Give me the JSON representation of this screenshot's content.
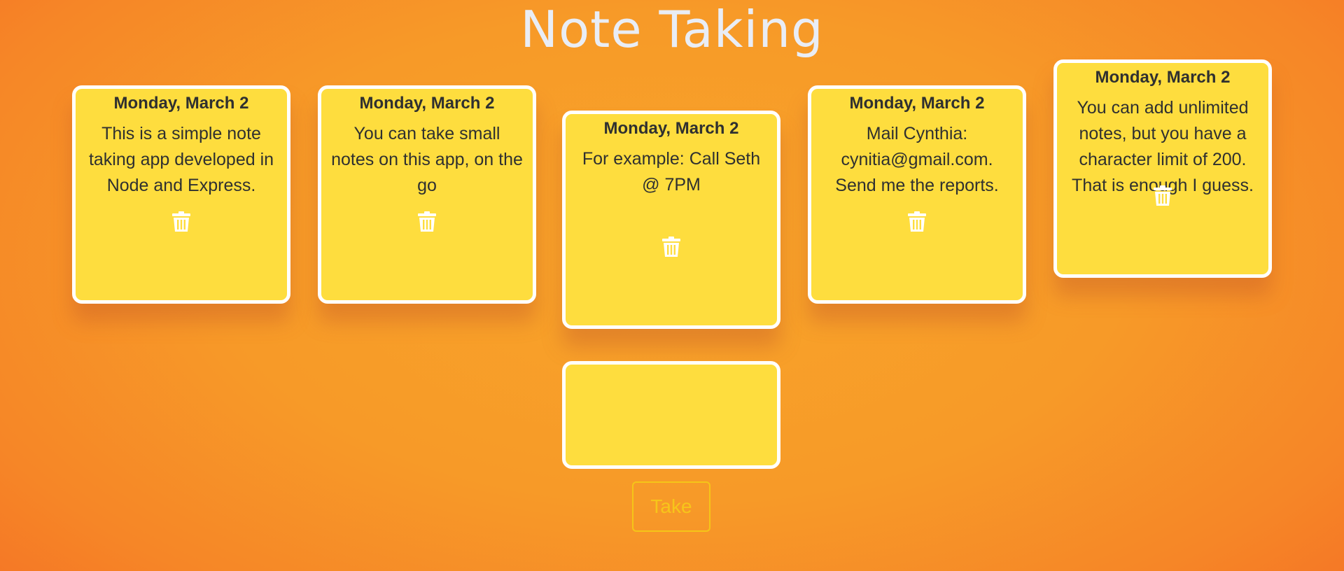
{
  "header": {
    "title": "Note Taking"
  },
  "notes": [
    {
      "date": "Monday, March 2",
      "text": "This is a simple note taking app developed in Node and Express.",
      "delete_icon": "trash-icon"
    },
    {
      "date": "Monday, March 2",
      "text": "You can take small notes on this app, on the go",
      "delete_icon": "trash-icon"
    },
    {
      "date": "Monday, March 2",
      "text": "For example: Call Seth @ 7PM",
      "delete_icon": "trash-icon"
    },
    {
      "date": "Monday, March 2",
      "text": "Mail Cynthia: cynitia@gmail.com. Send me the reports.",
      "delete_icon": "trash-icon"
    },
    {
      "date": "Monday, March 2",
      "text": "You can add unlimited notes, but you have a character limit of 200. That is enough I guess.",
      "delete_icon": "trash-icon"
    }
  ],
  "composer": {
    "value": "",
    "placeholder": "",
    "button_label": "Take"
  },
  "colors": {
    "note_background": "#fedd3e",
    "note_border": "#ffffff",
    "background_center": "#f8a42a",
    "background_edge": "#f46d24",
    "title_color": "#e9edf5",
    "button_color": "#f7c51a"
  }
}
